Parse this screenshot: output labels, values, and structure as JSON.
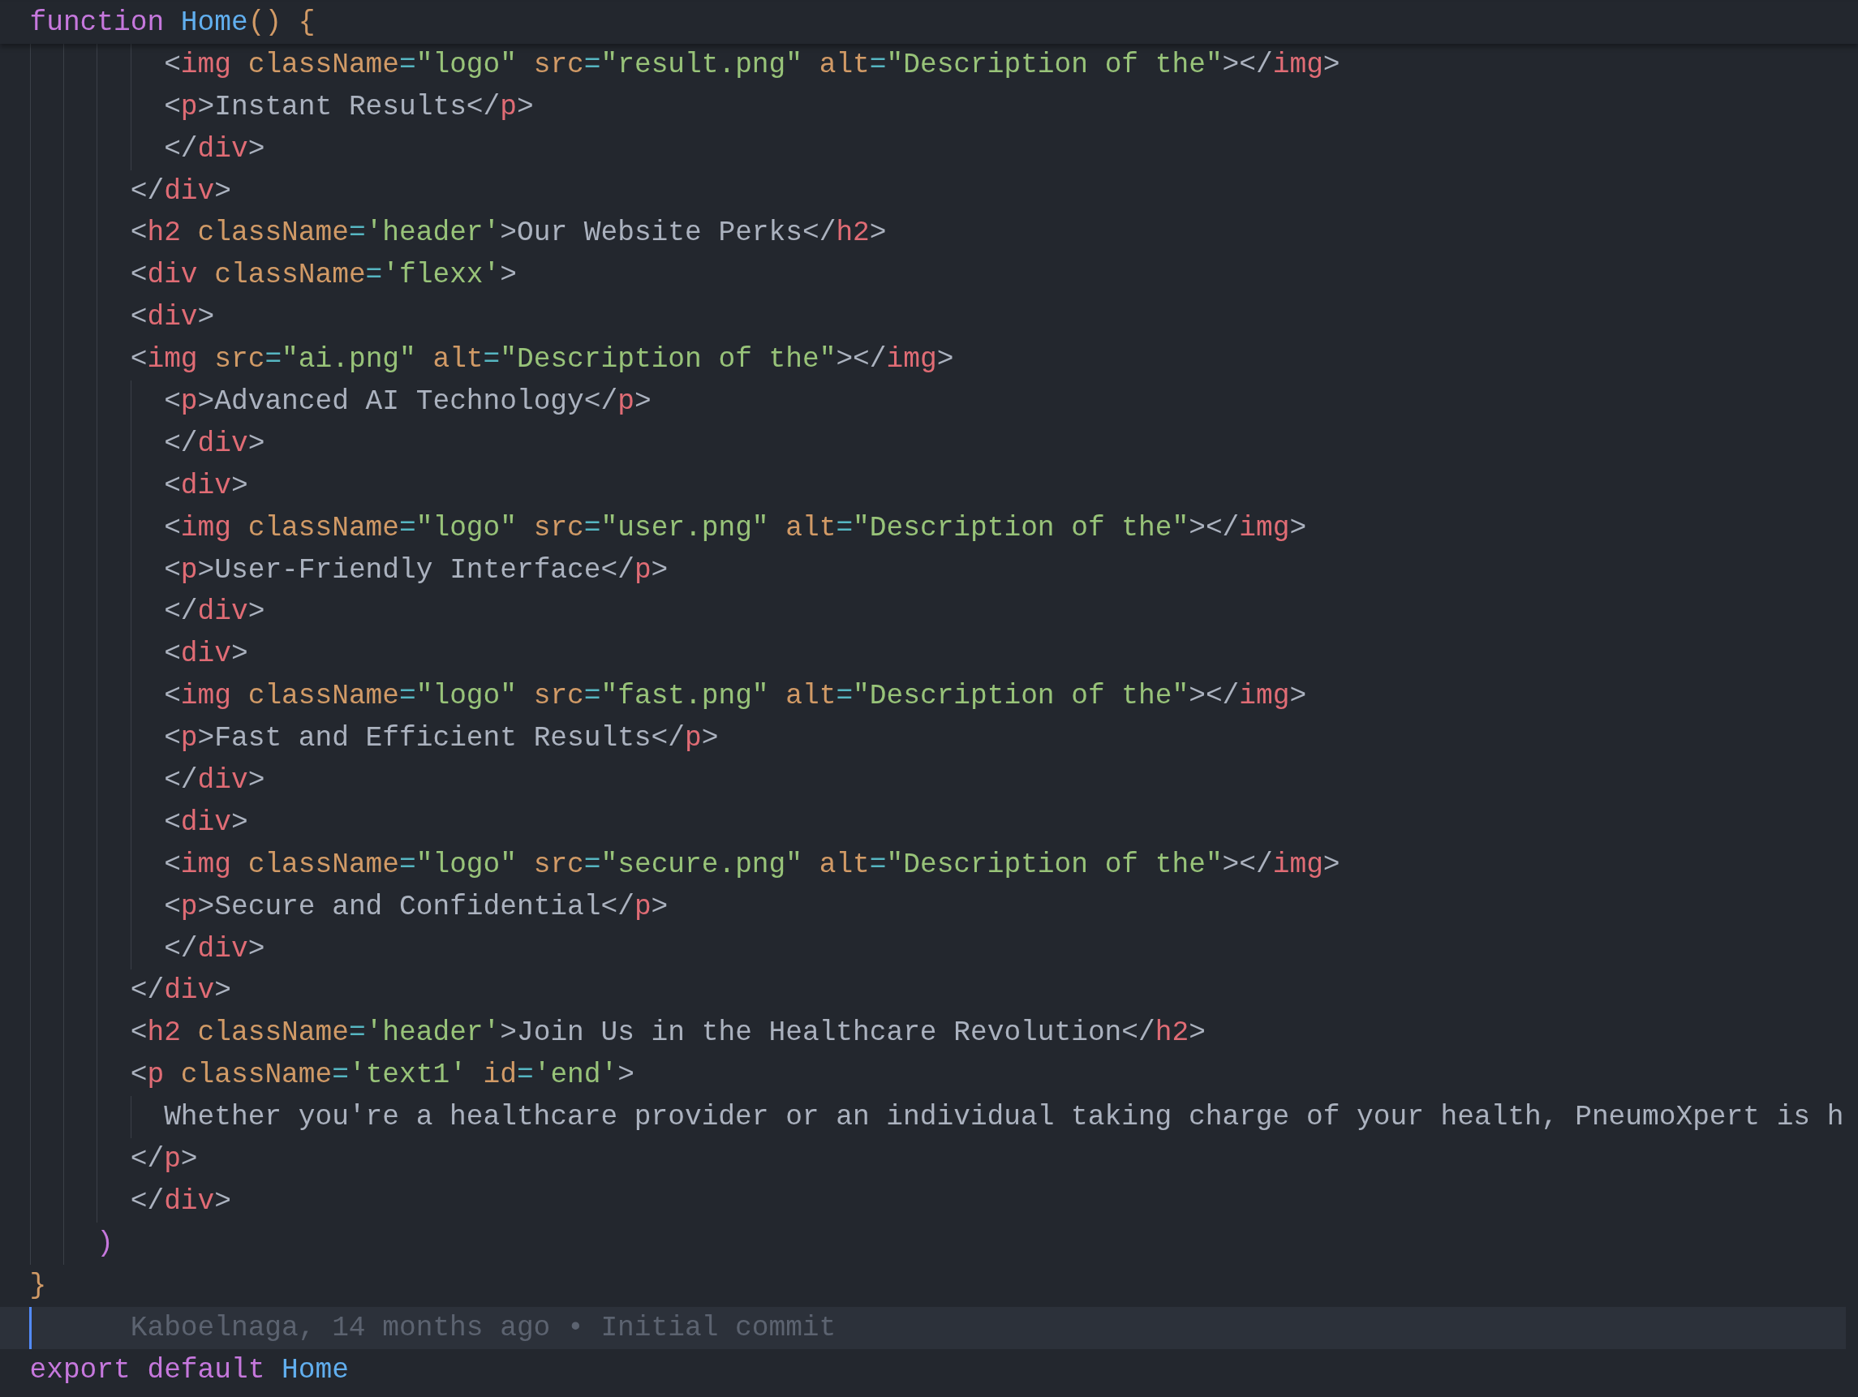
{
  "editor": {
    "lines": [
      {
        "kind": "sticky",
        "current": false,
        "tokens": [
          {
            "kind": "keyword",
            "text": "function"
          },
          {
            "kind": "function",
            "text": " Home"
          },
          {
            "kind": "bracket",
            "text": "() {"
          }
        ]
      },
      {
        "kind": "code",
        "current": false,
        "tokens": [
          {
            "kind": "punct",
            "text": "        <"
          },
          {
            "kind": "tag",
            "text": "img"
          },
          {
            "kind": "attr",
            "text": " className"
          },
          {
            "kind": "op",
            "text": "="
          },
          {
            "kind": "string",
            "text": "\"logo\""
          },
          {
            "kind": "attr",
            "text": " src"
          },
          {
            "kind": "op",
            "text": "="
          },
          {
            "kind": "string",
            "text": "\"result.png\""
          },
          {
            "kind": "attr",
            "text": " alt"
          },
          {
            "kind": "op",
            "text": "="
          },
          {
            "kind": "string",
            "text": "\"Description of the\""
          },
          {
            "kind": "punct",
            "text": "></"
          },
          {
            "kind": "tag",
            "text": "img"
          },
          {
            "kind": "punct",
            "text": ">"
          }
        ]
      },
      {
        "kind": "code",
        "current": false,
        "tokens": [
          {
            "kind": "punct",
            "text": "        <"
          },
          {
            "kind": "tag",
            "text": "p"
          },
          {
            "kind": "punct",
            "text": ">"
          },
          {
            "kind": "text",
            "text": "Instant Results"
          },
          {
            "kind": "punct",
            "text": "</"
          },
          {
            "kind": "tag",
            "text": "p"
          },
          {
            "kind": "punct",
            "text": ">"
          }
        ]
      },
      {
        "kind": "code",
        "current": false,
        "tokens": [
          {
            "kind": "punct",
            "text": "        </"
          },
          {
            "kind": "tag",
            "text": "div"
          },
          {
            "kind": "punct",
            "text": ">"
          }
        ]
      },
      {
        "kind": "code",
        "current": false,
        "tokens": [
          {
            "kind": "punct",
            "text": "      </"
          },
          {
            "kind": "tag",
            "text": "div"
          },
          {
            "kind": "punct",
            "text": ">"
          }
        ]
      },
      {
        "kind": "code",
        "current": false,
        "tokens": [
          {
            "kind": "punct",
            "text": "      <"
          },
          {
            "kind": "tag",
            "text": "h2"
          },
          {
            "kind": "attr",
            "text": " className"
          },
          {
            "kind": "op",
            "text": "="
          },
          {
            "kind": "string",
            "text": "'header'"
          },
          {
            "kind": "punct",
            "text": ">"
          },
          {
            "kind": "text",
            "text": "Our Website Perks"
          },
          {
            "kind": "punct",
            "text": "</"
          },
          {
            "kind": "tag",
            "text": "h2"
          },
          {
            "kind": "punct",
            "text": ">"
          }
        ]
      },
      {
        "kind": "code",
        "current": false,
        "tokens": [
          {
            "kind": "punct",
            "text": "      <"
          },
          {
            "kind": "tag",
            "text": "div"
          },
          {
            "kind": "attr",
            "text": " className"
          },
          {
            "kind": "op",
            "text": "="
          },
          {
            "kind": "string",
            "text": "'flexx'"
          },
          {
            "kind": "punct",
            "text": ">"
          }
        ]
      },
      {
        "kind": "code",
        "current": false,
        "tokens": [
          {
            "kind": "punct",
            "text": "      <"
          },
          {
            "kind": "tag",
            "text": "div"
          },
          {
            "kind": "punct",
            "text": ">"
          }
        ]
      },
      {
        "kind": "code",
        "current": false,
        "tokens": [
          {
            "kind": "punct",
            "text": "      <"
          },
          {
            "kind": "tag",
            "text": "img"
          },
          {
            "kind": "attr",
            "text": " src"
          },
          {
            "kind": "op",
            "text": "="
          },
          {
            "kind": "string",
            "text": "\"ai.png\""
          },
          {
            "kind": "attr",
            "text": " alt"
          },
          {
            "kind": "op",
            "text": "="
          },
          {
            "kind": "string",
            "text": "\"Description of the\""
          },
          {
            "kind": "punct",
            "text": "></"
          },
          {
            "kind": "tag",
            "text": "img"
          },
          {
            "kind": "punct",
            "text": ">"
          }
        ]
      },
      {
        "kind": "code",
        "current": false,
        "tokens": [
          {
            "kind": "punct",
            "text": "        <"
          },
          {
            "kind": "tag",
            "text": "p"
          },
          {
            "kind": "punct",
            "text": ">"
          },
          {
            "kind": "text",
            "text": "Advanced AI Technology"
          },
          {
            "kind": "punct",
            "text": "</"
          },
          {
            "kind": "tag",
            "text": "p"
          },
          {
            "kind": "punct",
            "text": ">"
          }
        ]
      },
      {
        "kind": "code",
        "current": false,
        "tokens": [
          {
            "kind": "punct",
            "text": "        </"
          },
          {
            "kind": "tag",
            "text": "div"
          },
          {
            "kind": "punct",
            "text": ">"
          }
        ]
      },
      {
        "kind": "code",
        "current": false,
        "tokens": [
          {
            "kind": "punct",
            "text": "        <"
          },
          {
            "kind": "tag",
            "text": "div"
          },
          {
            "kind": "punct",
            "text": ">"
          }
        ]
      },
      {
        "kind": "code",
        "current": false,
        "tokens": [
          {
            "kind": "punct",
            "text": "        <"
          },
          {
            "kind": "tag",
            "text": "img"
          },
          {
            "kind": "attr",
            "text": " className"
          },
          {
            "kind": "op",
            "text": "="
          },
          {
            "kind": "string",
            "text": "\"logo\""
          },
          {
            "kind": "attr",
            "text": " src"
          },
          {
            "kind": "op",
            "text": "="
          },
          {
            "kind": "string",
            "text": "\"user.png\""
          },
          {
            "kind": "attr",
            "text": " alt"
          },
          {
            "kind": "op",
            "text": "="
          },
          {
            "kind": "string",
            "text": "\"Description of the\""
          },
          {
            "kind": "punct",
            "text": "></"
          },
          {
            "kind": "tag",
            "text": "img"
          },
          {
            "kind": "punct",
            "text": ">"
          }
        ]
      },
      {
        "kind": "code",
        "current": false,
        "tokens": [
          {
            "kind": "punct",
            "text": "        <"
          },
          {
            "kind": "tag",
            "text": "p"
          },
          {
            "kind": "punct",
            "text": ">"
          },
          {
            "kind": "text",
            "text": "User-Friendly Interface"
          },
          {
            "kind": "punct",
            "text": "</"
          },
          {
            "kind": "tag",
            "text": "p"
          },
          {
            "kind": "punct",
            "text": ">"
          }
        ]
      },
      {
        "kind": "code",
        "current": false,
        "tokens": [
          {
            "kind": "punct",
            "text": "        </"
          },
          {
            "kind": "tag",
            "text": "div"
          },
          {
            "kind": "punct",
            "text": ">"
          }
        ]
      },
      {
        "kind": "code",
        "current": false,
        "tokens": [
          {
            "kind": "punct",
            "text": "        <"
          },
          {
            "kind": "tag",
            "text": "div"
          },
          {
            "kind": "punct",
            "text": ">"
          }
        ]
      },
      {
        "kind": "code",
        "current": false,
        "tokens": [
          {
            "kind": "punct",
            "text": "        <"
          },
          {
            "kind": "tag",
            "text": "img"
          },
          {
            "kind": "attr",
            "text": " className"
          },
          {
            "kind": "op",
            "text": "="
          },
          {
            "kind": "string",
            "text": "\"logo\""
          },
          {
            "kind": "attr",
            "text": " src"
          },
          {
            "kind": "op",
            "text": "="
          },
          {
            "kind": "string",
            "text": "\"fast.png\""
          },
          {
            "kind": "attr",
            "text": " alt"
          },
          {
            "kind": "op",
            "text": "="
          },
          {
            "kind": "string",
            "text": "\"Description of the\""
          },
          {
            "kind": "punct",
            "text": "></"
          },
          {
            "kind": "tag",
            "text": "img"
          },
          {
            "kind": "punct",
            "text": ">"
          }
        ]
      },
      {
        "kind": "code",
        "current": false,
        "tokens": [
          {
            "kind": "punct",
            "text": "        <"
          },
          {
            "kind": "tag",
            "text": "p"
          },
          {
            "kind": "punct",
            "text": ">"
          },
          {
            "kind": "text",
            "text": "Fast and Efficient Results"
          },
          {
            "kind": "punct",
            "text": "</"
          },
          {
            "kind": "tag",
            "text": "p"
          },
          {
            "kind": "punct",
            "text": ">"
          }
        ]
      },
      {
        "kind": "code",
        "current": false,
        "tokens": [
          {
            "kind": "punct",
            "text": "        </"
          },
          {
            "kind": "tag",
            "text": "div"
          },
          {
            "kind": "punct",
            "text": ">"
          }
        ]
      },
      {
        "kind": "code",
        "current": false,
        "tokens": [
          {
            "kind": "punct",
            "text": "        <"
          },
          {
            "kind": "tag",
            "text": "div"
          },
          {
            "kind": "punct",
            "text": ">"
          }
        ]
      },
      {
        "kind": "code",
        "current": false,
        "tokens": [
          {
            "kind": "punct",
            "text": "        <"
          },
          {
            "kind": "tag",
            "text": "img"
          },
          {
            "kind": "attr",
            "text": " className"
          },
          {
            "kind": "op",
            "text": "="
          },
          {
            "kind": "string",
            "text": "\"logo\""
          },
          {
            "kind": "attr",
            "text": " src"
          },
          {
            "kind": "op",
            "text": "="
          },
          {
            "kind": "string",
            "text": "\"secure.png\""
          },
          {
            "kind": "attr",
            "text": " alt"
          },
          {
            "kind": "op",
            "text": "="
          },
          {
            "kind": "string",
            "text": "\"Description of the\""
          },
          {
            "kind": "punct",
            "text": "></"
          },
          {
            "kind": "tag",
            "text": "img"
          },
          {
            "kind": "punct",
            "text": ">"
          }
        ]
      },
      {
        "kind": "code",
        "current": false,
        "tokens": [
          {
            "kind": "punct",
            "text": "        <"
          },
          {
            "kind": "tag",
            "text": "p"
          },
          {
            "kind": "punct",
            "text": ">"
          },
          {
            "kind": "text",
            "text": "Secure and Confidential"
          },
          {
            "kind": "punct",
            "text": "</"
          },
          {
            "kind": "tag",
            "text": "p"
          },
          {
            "kind": "punct",
            "text": ">"
          }
        ]
      },
      {
        "kind": "code",
        "current": false,
        "tokens": [
          {
            "kind": "punct",
            "text": "        </"
          },
          {
            "kind": "tag",
            "text": "div"
          },
          {
            "kind": "punct",
            "text": ">"
          }
        ]
      },
      {
        "kind": "code",
        "current": false,
        "tokens": [
          {
            "kind": "punct",
            "text": "      </"
          },
          {
            "kind": "tag",
            "text": "div"
          },
          {
            "kind": "punct",
            "text": ">"
          }
        ]
      },
      {
        "kind": "code",
        "current": false,
        "tokens": [
          {
            "kind": "punct",
            "text": "      <"
          },
          {
            "kind": "tag",
            "text": "h2"
          },
          {
            "kind": "attr",
            "text": " className"
          },
          {
            "kind": "op",
            "text": "="
          },
          {
            "kind": "string",
            "text": "'header'"
          },
          {
            "kind": "punct",
            "text": ">"
          },
          {
            "kind": "text",
            "text": "Join Us in the Healthcare Revolution"
          },
          {
            "kind": "punct",
            "text": "</"
          },
          {
            "kind": "tag",
            "text": "h2"
          },
          {
            "kind": "punct",
            "text": ">"
          }
        ]
      },
      {
        "kind": "code",
        "current": false,
        "tokens": [
          {
            "kind": "punct",
            "text": "      <"
          },
          {
            "kind": "tag",
            "text": "p"
          },
          {
            "kind": "attr",
            "text": " className"
          },
          {
            "kind": "op",
            "text": "="
          },
          {
            "kind": "string",
            "text": "'text1'"
          },
          {
            "kind": "attr",
            "text": " id"
          },
          {
            "kind": "op",
            "text": "="
          },
          {
            "kind": "string",
            "text": "'end'"
          },
          {
            "kind": "punct",
            "text": ">"
          }
        ]
      },
      {
        "kind": "code",
        "current": false,
        "tokens": [
          {
            "kind": "text",
            "text": "        Whether you're a healthcare provider or an individual taking charge of your health, PneumoXpert is h"
          }
        ]
      },
      {
        "kind": "code",
        "current": false,
        "tokens": [
          {
            "kind": "punct",
            "text": "      </"
          },
          {
            "kind": "tag",
            "text": "p"
          },
          {
            "kind": "punct",
            "text": ">"
          }
        ]
      },
      {
        "kind": "code",
        "current": false,
        "tokens": [
          {
            "kind": "punct",
            "text": "      </"
          },
          {
            "kind": "tag",
            "text": "div"
          },
          {
            "kind": "punct",
            "text": ">"
          }
        ]
      },
      {
        "kind": "code",
        "current": false,
        "tokens": [
          {
            "kind": "bracket2",
            "text": "    )"
          }
        ]
      },
      {
        "kind": "code",
        "current": false,
        "tokens": [
          {
            "kind": "bracket",
            "text": "}"
          }
        ]
      },
      {
        "kind": "blame",
        "current": true,
        "tokens": [
          {
            "kind": "blame",
            "text": "      Kaboelnaga, 14 months ago • Initial commit"
          }
        ]
      },
      {
        "kind": "code",
        "current": false,
        "tokens": [
          {
            "kind": "keyword",
            "text": "export"
          },
          {
            "kind": "keyword",
            "text": " default"
          },
          {
            "kind": "function",
            "text": " Home"
          }
        ]
      }
    ]
  }
}
